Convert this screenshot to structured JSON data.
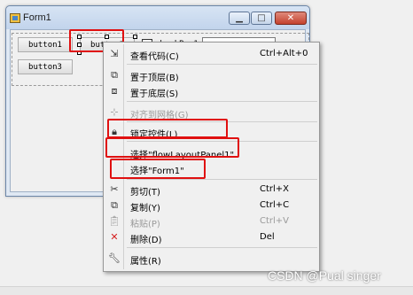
{
  "window": {
    "title": "Form1",
    "buttons": {
      "minimize": "▁",
      "maximize": "□",
      "close": "✕"
    }
  },
  "form": {
    "button1": "button1",
    "button2": "button2",
    "button3": "button3",
    "checkbox": "checkBox1"
  },
  "menu": {
    "items": [
      {
        "label": "查看代码(C)",
        "shortcut": "Ctrl+Alt+0",
        "icon": "view-code-icon",
        "enabled": true
      },
      {
        "label": "置于顶层(B)",
        "shortcut": "",
        "icon": "bring-to-front-icon",
        "enabled": true
      },
      {
        "label": "置于底层(S)",
        "shortcut": "",
        "icon": "send-to-back-icon",
        "enabled": true
      },
      {
        "label": "对齐到网格(G)",
        "shortcut": "",
        "icon": "align-grid-icon",
        "enabled": false
      },
      {
        "label": "锁定控件(L)",
        "shortcut": "",
        "icon": "lock-icon",
        "enabled": true
      },
      {
        "label": "选择\"flowLayoutPanel1\"",
        "shortcut": "",
        "icon": "",
        "enabled": true
      },
      {
        "label": "选择\"Form1\"",
        "shortcut": "",
        "icon": "",
        "enabled": true
      },
      {
        "label": "剪切(T)",
        "shortcut": "Ctrl+X",
        "icon": "cut-icon",
        "enabled": true
      },
      {
        "label": "复制(Y)",
        "shortcut": "Ctrl+C",
        "icon": "copy-icon",
        "enabled": true
      },
      {
        "label": "粘贴(P)",
        "shortcut": "Ctrl+V",
        "icon": "paste-icon",
        "enabled": false
      },
      {
        "label": "删除(D)",
        "shortcut": "Del",
        "icon": "delete-icon",
        "enabled": true
      },
      {
        "label": "属性(R)",
        "shortcut": "",
        "icon": "properties-icon",
        "enabled": true
      }
    ]
  },
  "watermark": "CSDN @Pual singer",
  "colors": {
    "highlight_box": "#e01010",
    "delete_icon": "#d42020"
  }
}
